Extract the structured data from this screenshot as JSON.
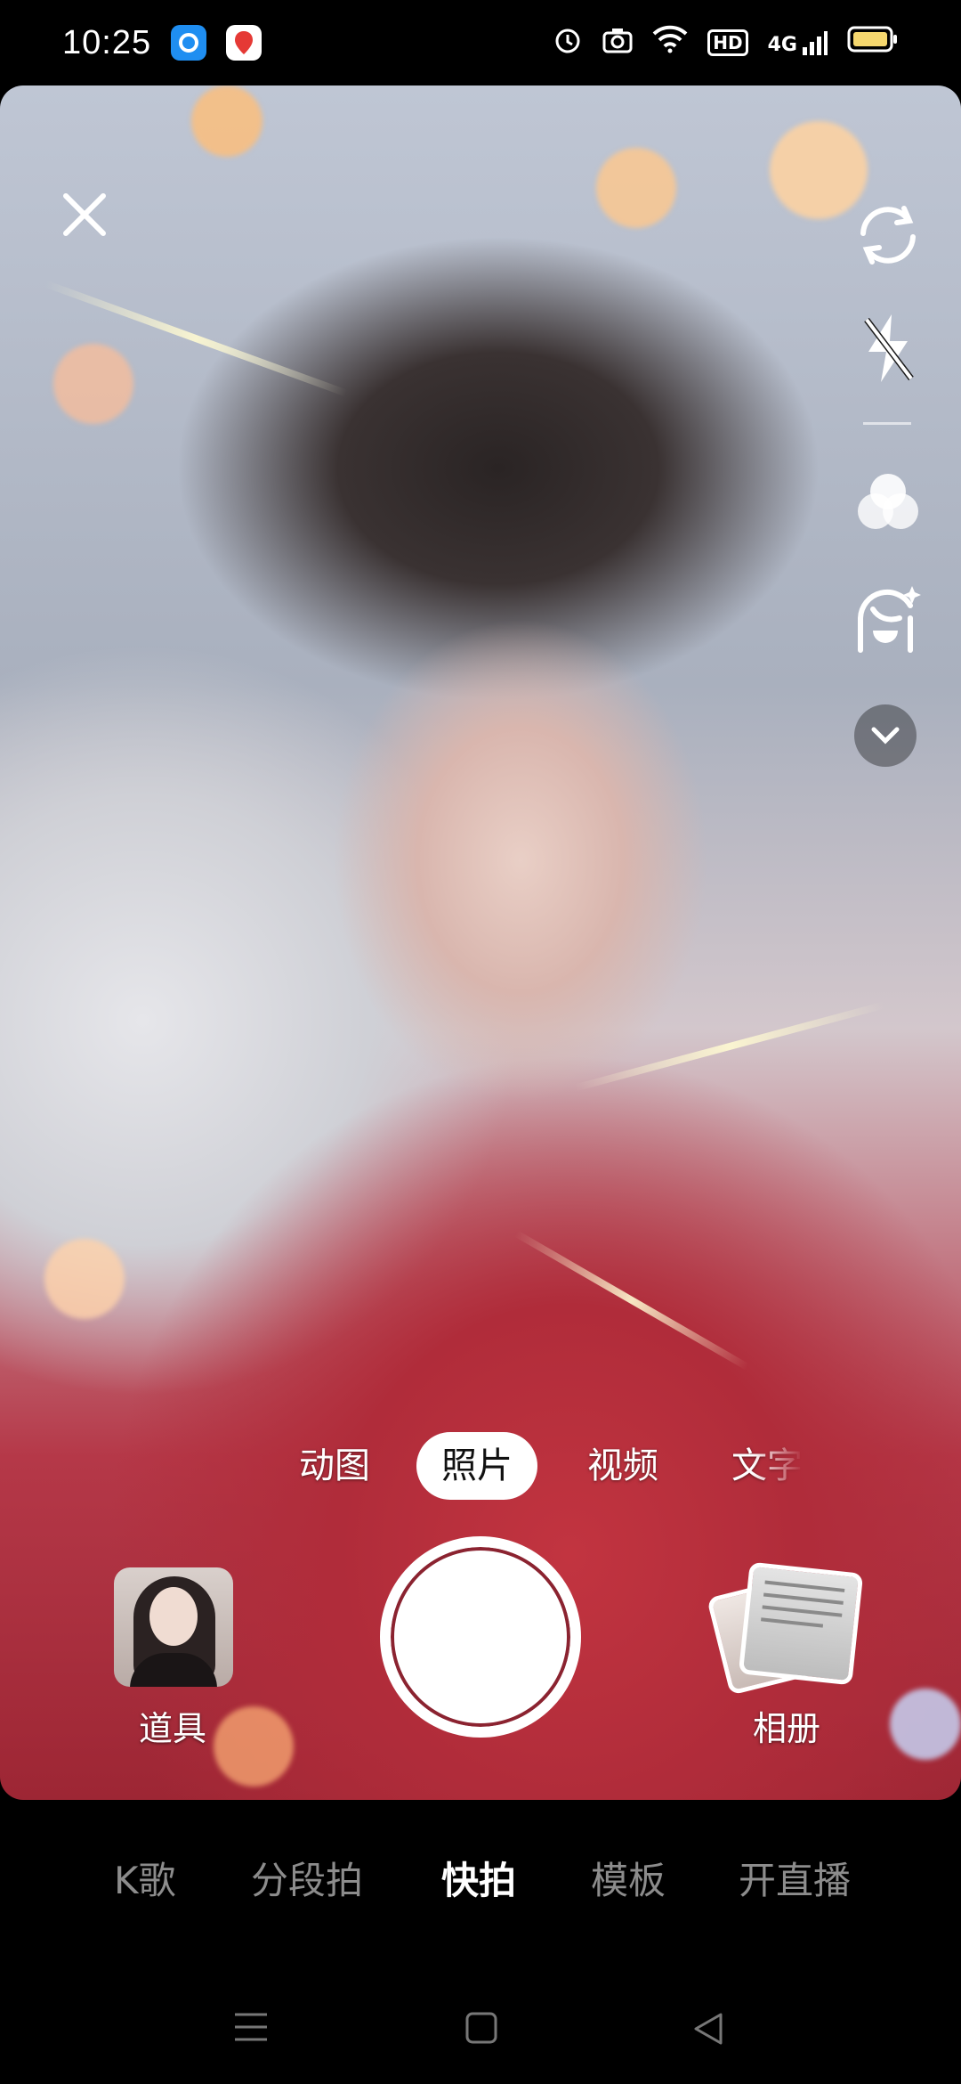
{
  "status": {
    "time": "10:25",
    "hd_label": "HD",
    "network": "4G",
    "battery_color": "#f5d76e"
  },
  "camera": {
    "close_icon": "close-icon",
    "flip_icon": "flip-camera-icon",
    "flash_icon": "flash-off-icon",
    "filter_icon": "filter-icon",
    "beauty_icon": "beauty-icon",
    "more_icon": "chevron-down-icon"
  },
  "modes": {
    "items": [
      "动图",
      "照片",
      "视频",
      "文字"
    ],
    "active": "照片"
  },
  "controls": {
    "props_label": "道具",
    "album_label": "相册"
  },
  "bottom_tabs": {
    "items": [
      "K歌",
      "分段拍",
      "快拍",
      "模板",
      "开直播"
    ],
    "active": "快拍"
  },
  "nav": {
    "menu_icon": "menu-icon",
    "home_icon": "home-icon",
    "back_icon": "back-icon"
  }
}
